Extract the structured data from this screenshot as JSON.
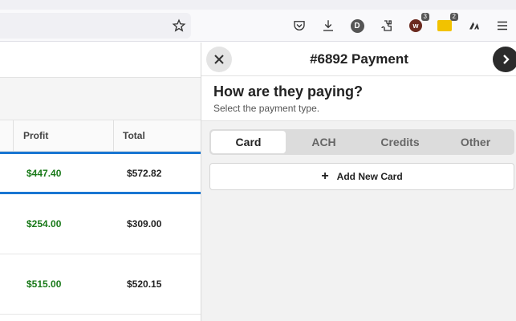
{
  "browser": {
    "extension_badges": {
      "w": "3",
      "y": "2"
    },
    "account_initial": "D"
  },
  "table": {
    "columns": [
      "Profit",
      "Total"
    ],
    "rows": [
      {
        "profit": "$447.40",
        "total": "$572.82",
        "selected": true
      },
      {
        "profit": "$254.00",
        "total": "$309.00",
        "selected": false
      },
      {
        "profit": "$515.00",
        "total": "$520.15",
        "selected": false
      }
    ]
  },
  "panel": {
    "title": "#6892 Payment",
    "question": "How are they paying?",
    "subtitle": "Select the payment type.",
    "tabs": [
      {
        "label": "Card",
        "active": true
      },
      {
        "label": "ACH",
        "active": false
      },
      {
        "label": "Credits",
        "active": false
      },
      {
        "label": "Other",
        "active": false
      }
    ],
    "add_card_label": "Add New Card"
  },
  "colors": {
    "profit": "#1a7a1a",
    "selection": "#1976d2",
    "next_button": "#2b2b2b"
  }
}
